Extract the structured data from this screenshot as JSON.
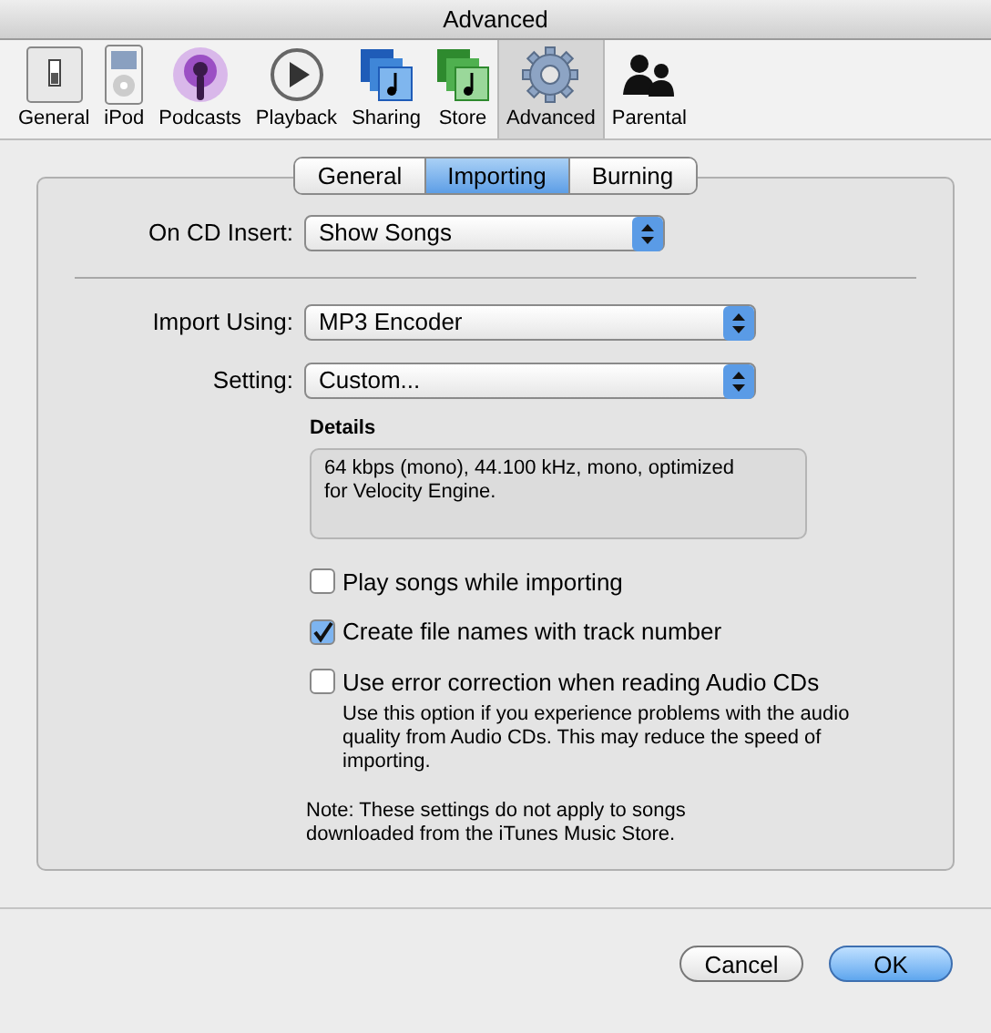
{
  "window": {
    "title": "Advanced"
  },
  "toolbar": [
    {
      "label": "General",
      "kind": "switch",
      "selected": false
    },
    {
      "label": "iPod",
      "kind": "ipod",
      "selected": false
    },
    {
      "label": "Podcasts",
      "kind": "podcast",
      "selected": false
    },
    {
      "label": "Playback",
      "kind": "play",
      "selected": false
    },
    {
      "label": "Sharing",
      "kind": "sharing",
      "selected": false
    },
    {
      "label": "Store",
      "kind": "store",
      "selected": false
    },
    {
      "label": "Advanced",
      "kind": "gear",
      "selected": true
    },
    {
      "label": "Parental",
      "kind": "people",
      "selected": false
    }
  ],
  "tabs": [
    {
      "label": "General",
      "selected": false
    },
    {
      "label": "Importing",
      "selected": true
    },
    {
      "label": "Burning",
      "selected": false
    }
  ],
  "cd_insert": {
    "label": "On CD Insert:",
    "value": "Show Songs"
  },
  "import_using": {
    "label": "Import Using:",
    "value": "MP3 Encoder"
  },
  "setting": {
    "label": "Setting:",
    "value": "Custom..."
  },
  "details": {
    "label": "Details",
    "text": "64 kbps (mono), 44.100 kHz, mono, optimized for Velocity Engine."
  },
  "checkboxes": [
    {
      "label": "Play songs while importing",
      "checked": false
    },
    {
      "label": "Create file names with track number",
      "checked": true
    },
    {
      "label": "Use error correction when reading Audio CDs",
      "checked": false,
      "note": "Use this option if you experience problems with the audio quality from Audio CDs. This may reduce the speed of importing."
    }
  ],
  "note": "Note: These settings do not apply to songs downloaded from the iTunes Music Store.",
  "buttons": [
    {
      "label": "Cancel",
      "default": false
    },
    {
      "label": "OK",
      "default": true
    }
  ]
}
